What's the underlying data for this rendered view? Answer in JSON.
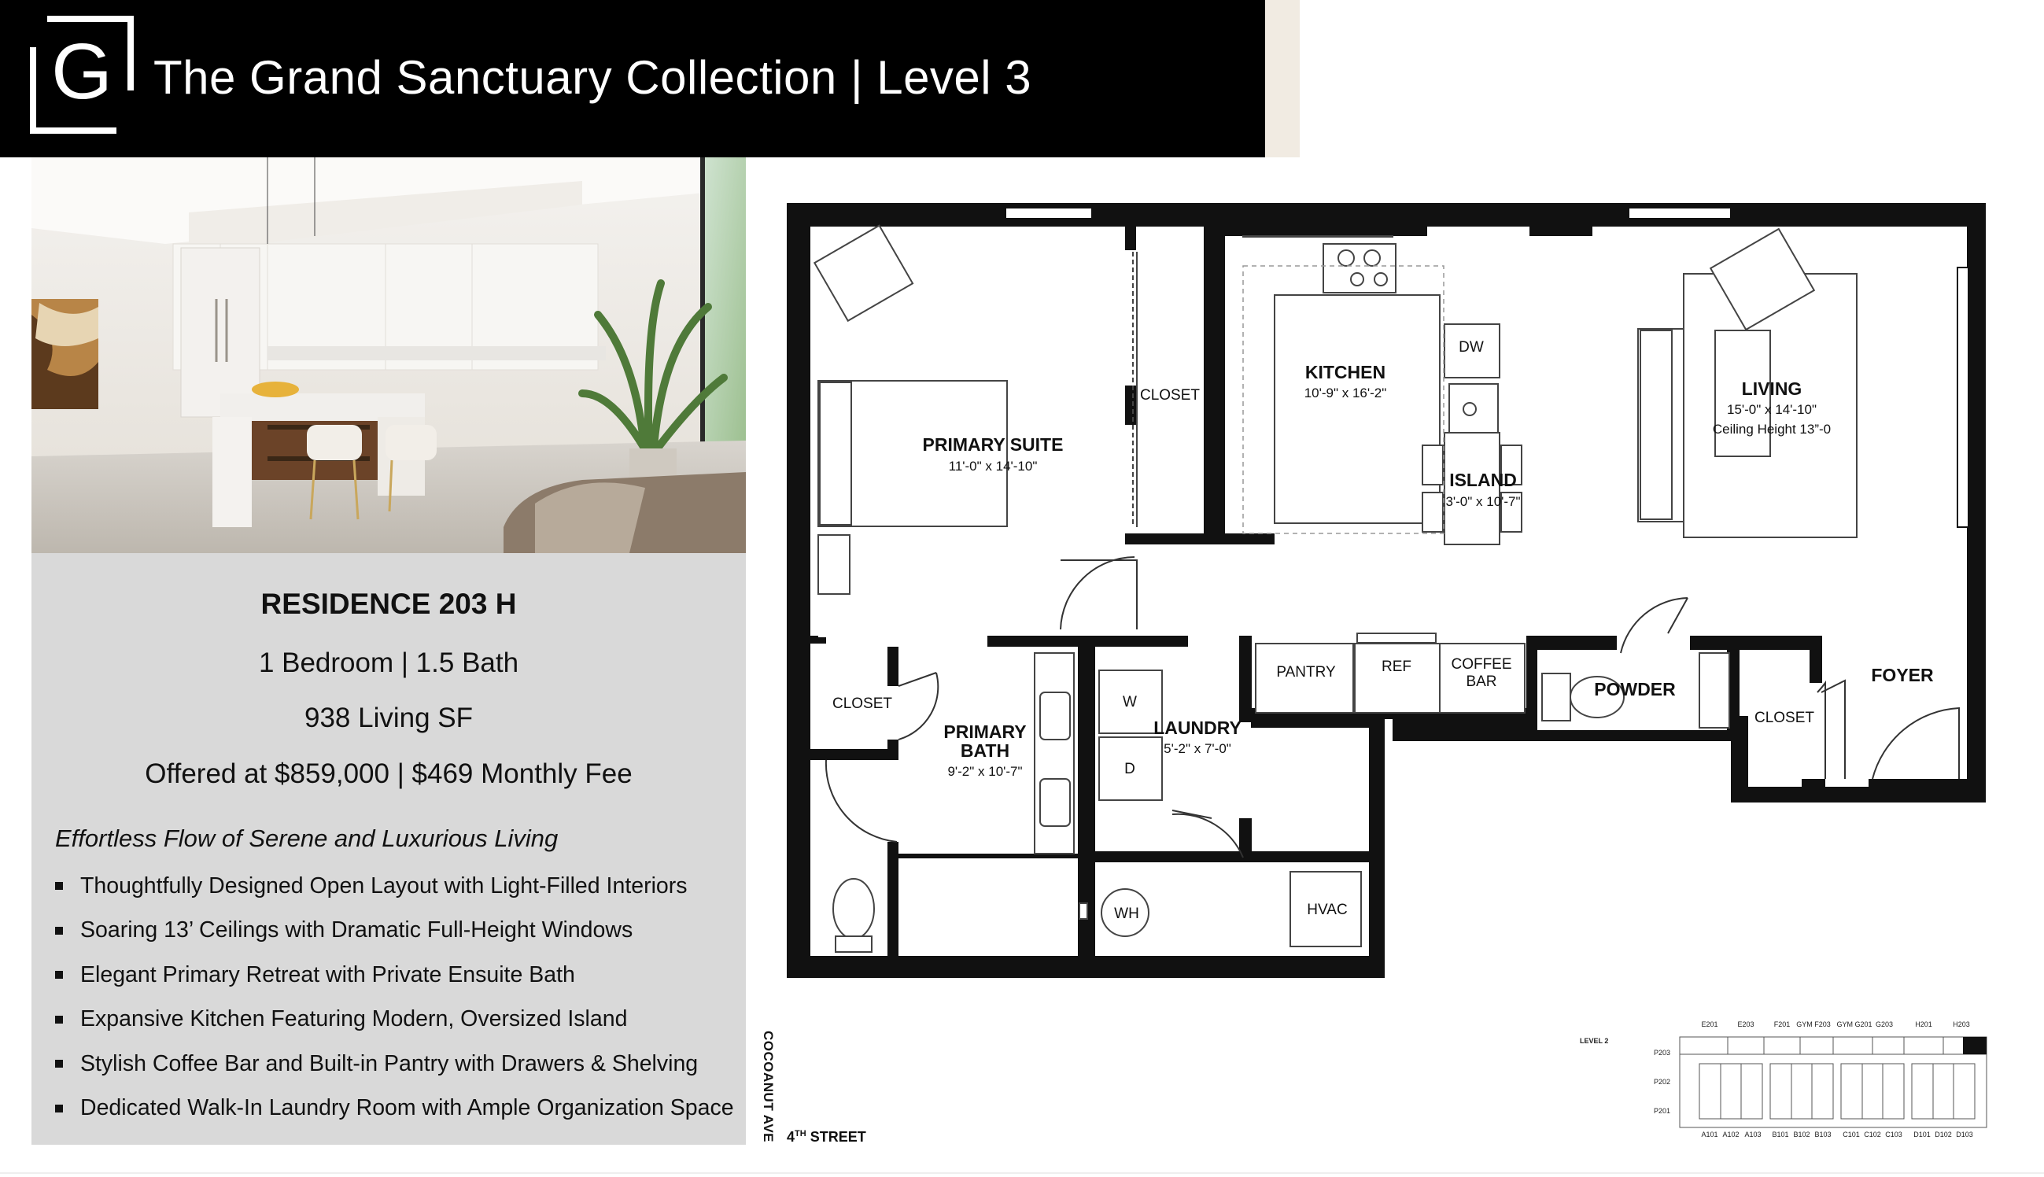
{
  "header": {
    "title": "The Grand Sanctuary Collection | Level 3",
    "logo_letter": "G"
  },
  "residence": {
    "name": "RESIDENCE 203 H",
    "bedbath": "1 Bedroom | 1.5 Bath",
    "area": "938 Living SF",
    "price": "Offered at $859,000 | $469 Monthly Fee",
    "tagline": "Effortless Flow of Serene and Luxurious Living",
    "features": [
      "Thoughtfully Designed Open Layout with Light-Filled Interiors",
      "Soaring 13’ Ceilings with Dramatic Full-Height Windows",
      "Elegant Primary Retreat with Private Ensuite Bath",
      "Expansive Kitchen Featuring Modern, Oversized Island",
      "Stylish Coffee Bar and Built-in Pantry with Drawers & Shelving",
      "Dedicated Walk-In Laundry Room with Ample Organization Space"
    ]
  },
  "floorplan": {
    "primary_suite": {
      "name": "PRIMARY SUITE",
      "dim": "11'-0\" x 14'-10\""
    },
    "closet_1": "CLOSET",
    "kitchen": {
      "name": "KITCHEN",
      "dim": "10'-9\" x 16'-2\""
    },
    "dw": "DW",
    "island": {
      "name": "ISLAND",
      "dim": "3'-0\" x 10'-7\""
    },
    "living": {
      "name": "LIVING",
      "dim": "15'-0\" x 14'-10\"",
      "ceiling": "Ceiling Height 13”-0"
    },
    "closet_2": "CLOSET",
    "primary_bath": {
      "name_1": "PRIMARY",
      "name_2": "BATH",
      "dim": "9'-2\" x 10'-7\""
    },
    "washer": "W",
    "dryer": "D",
    "laundry": {
      "name": "LAUNDRY",
      "dim": "5'-2\" x 7'-0\""
    },
    "pantry": "PANTRY",
    "ref": "REF",
    "coffee_bar_1": "COFFEE",
    "coffee_bar_2": "BAR",
    "powder": "POWDER",
    "closet_3": "CLOSET",
    "foyer": "FOYER",
    "wh": "WH",
    "hvac": "HVAC"
  },
  "streets": {
    "vertical": "COCOANUT AVE",
    "horizontal_num": "4",
    "horizontal_sup": "TH",
    "horizontal_rest": " STREET"
  },
  "keyplan": {
    "level": "LEVEL 2",
    "top_units": [
      "E201",
      "E203",
      "F201",
      "GYM F203",
      "GYM G201",
      "G203",
      "H201",
      "H203"
    ],
    "side_units": [
      "P203",
      "P202",
      "P201"
    ],
    "bottom_units": [
      "A101",
      "A102",
      "A103",
      "B101",
      "B102",
      "B103",
      "C101",
      "C102",
      "C103",
      "D101",
      "D102",
      "D103"
    ]
  }
}
